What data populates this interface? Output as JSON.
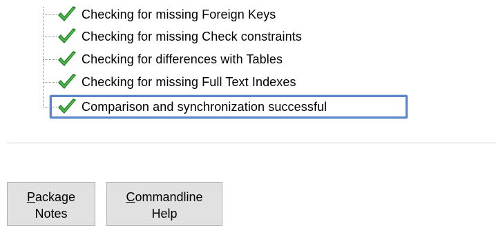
{
  "tree": {
    "items": [
      {
        "label": "Checking for missing Foreign Keys",
        "icon": "check-icon"
      },
      {
        "label": "Checking for missing Check constraints",
        "icon": "check-icon"
      },
      {
        "label": "Checking for differences with Tables",
        "icon": "check-icon"
      },
      {
        "label": "Checking for missing Full Text Indexes",
        "icon": "check-icon"
      },
      {
        "label": "Comparison and synchronization successful",
        "icon": "check-icon"
      }
    ]
  },
  "buttons": {
    "package_notes": {
      "mnemonic": "P",
      "line1_rest": "ackage",
      "line2": "Notes"
    },
    "commandline_help": {
      "mnemonic": "C",
      "line1_rest": "ommandline",
      "line2": "Help"
    }
  },
  "colors": {
    "check": "#3aa53a",
    "highlight_border": "#5b87c7"
  }
}
